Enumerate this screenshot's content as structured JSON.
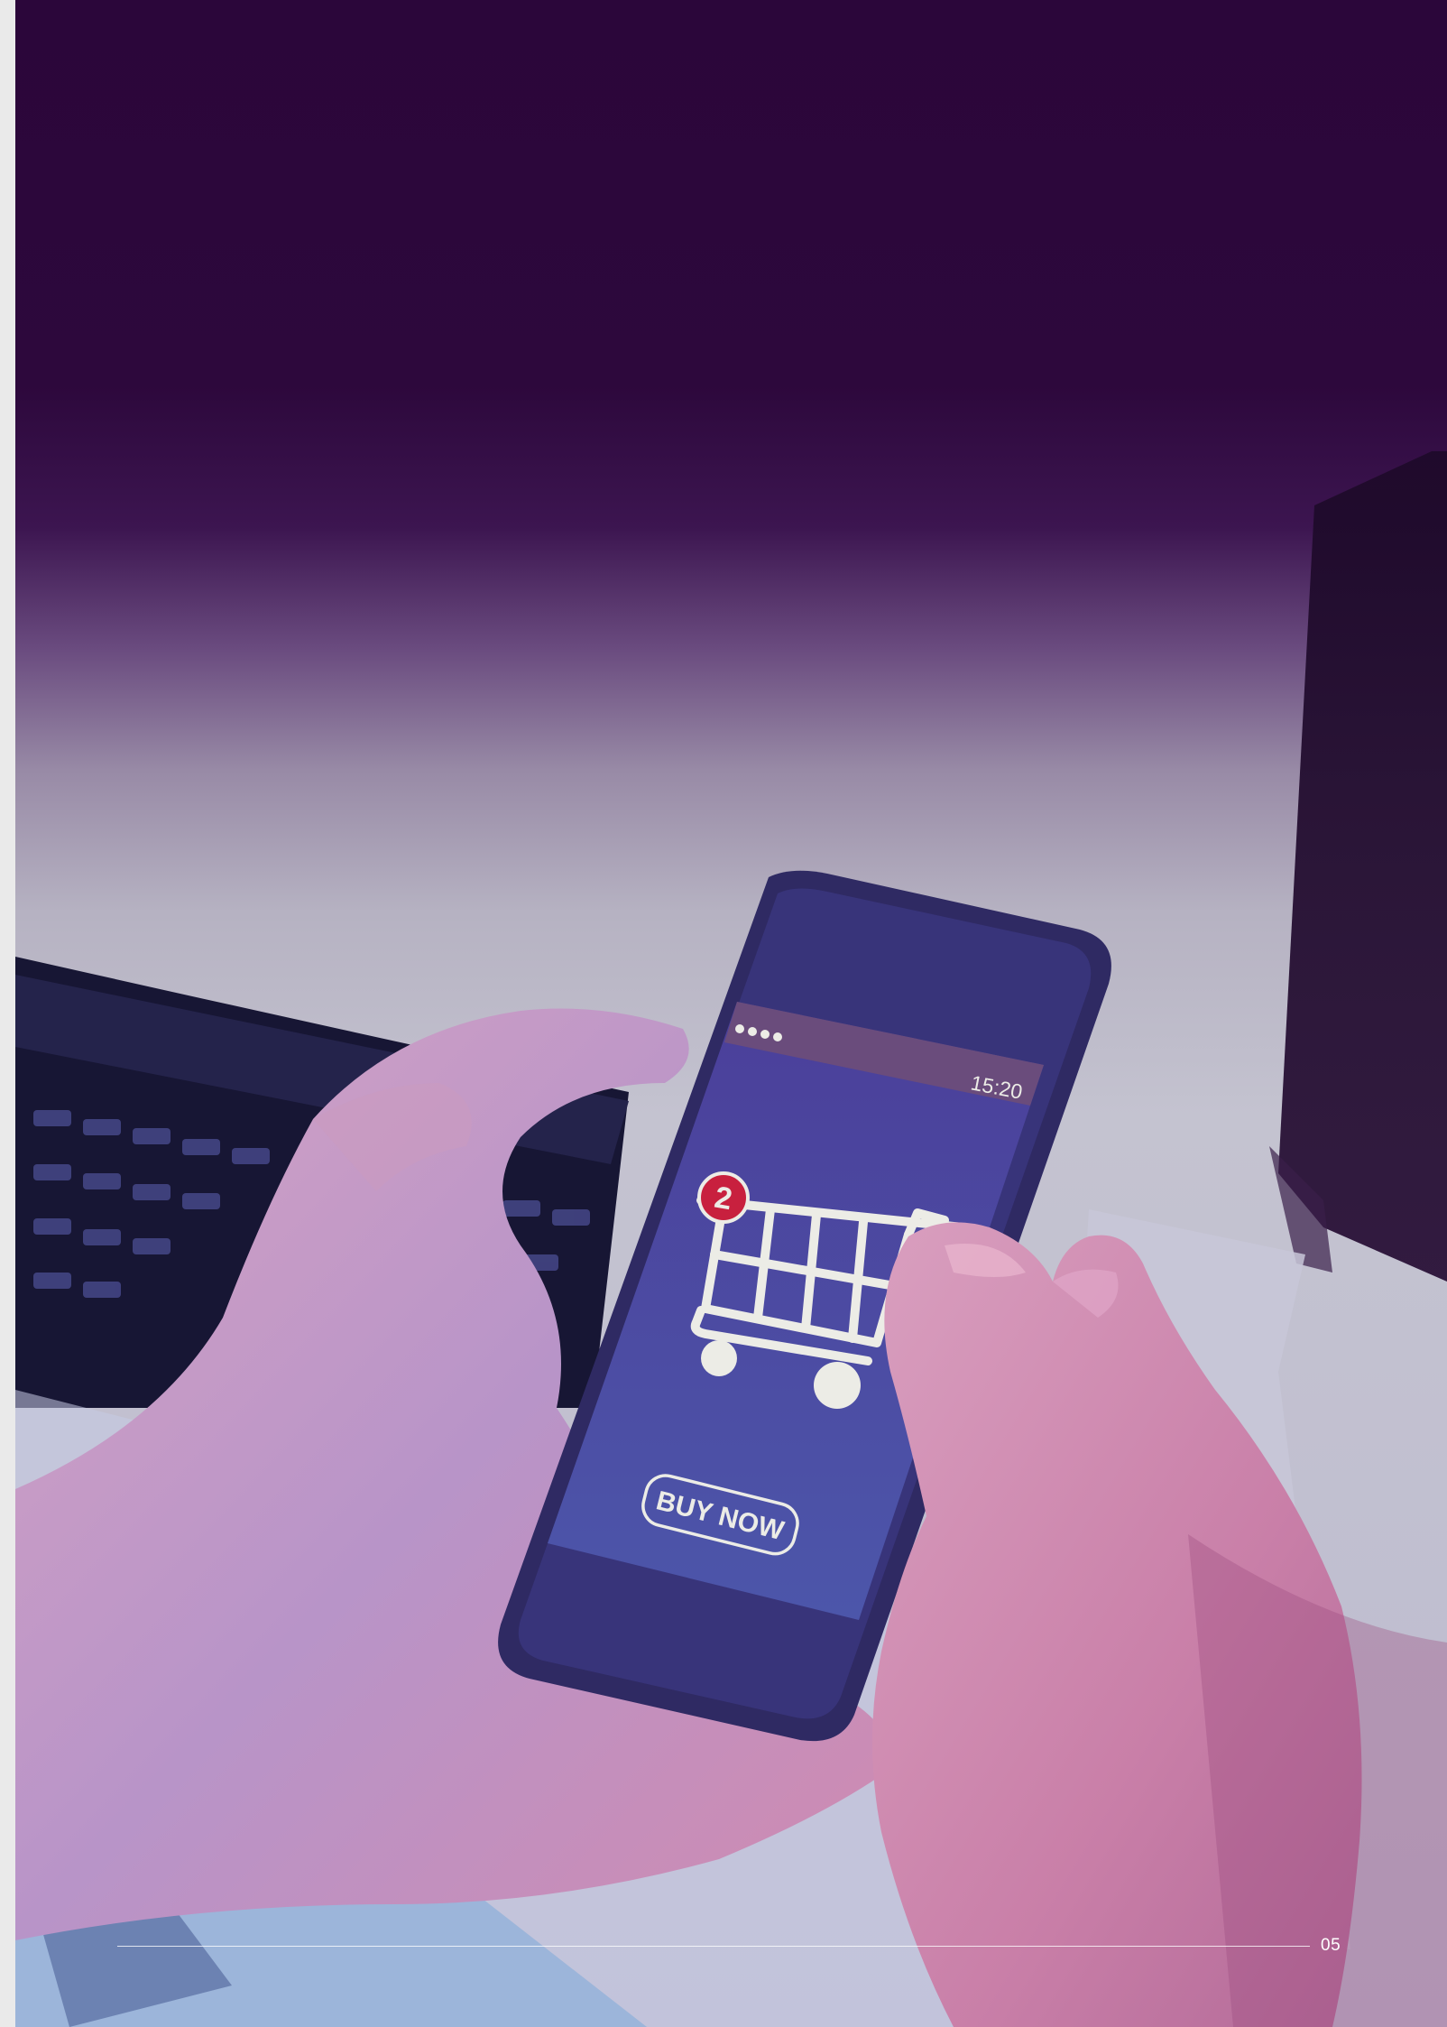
{
  "photo": {
    "phone_status": {
      "clock": "15:20"
    },
    "phone_screen": {
      "cart_badge_count": "2",
      "buy_button_label": "BUY NOW"
    },
    "colors": {
      "top_overlay": "#2a0838",
      "screen_blue": "#4a4fa8",
      "badge_red": "#c8203e",
      "cart_white": "#ecece6"
    }
  },
  "footer": {
    "page_number": "05"
  }
}
